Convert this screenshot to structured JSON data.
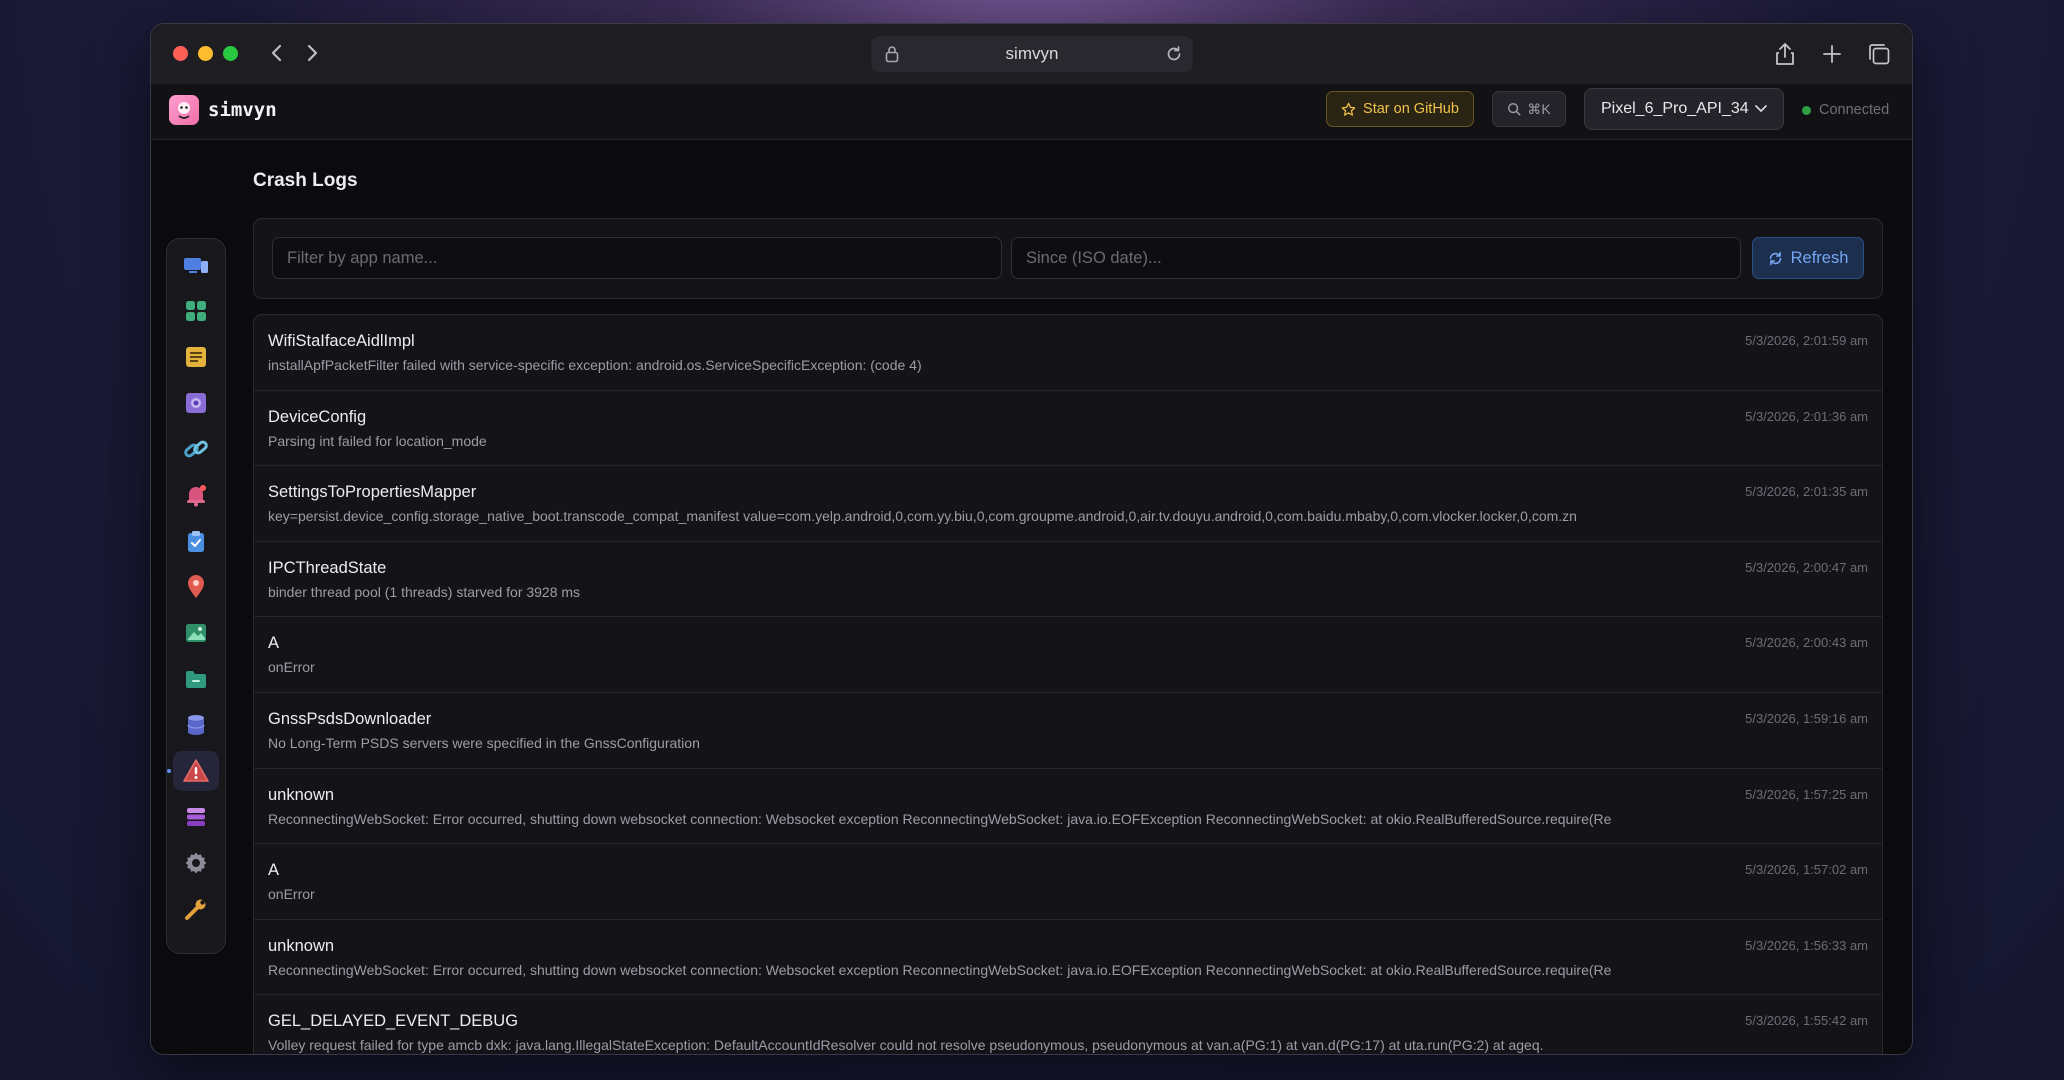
{
  "browser": {
    "url": "simvyn"
  },
  "header": {
    "brand": "simvyn",
    "star_label": "Star on GitHub",
    "shortcut": "⌘K",
    "device": "Pixel_6_Pro_API_34",
    "status": "Connected"
  },
  "sidebar": {
    "items": [
      {
        "icon": "devices-icon",
        "color": "#5b8ef0"
      },
      {
        "icon": "apps-grid-icon",
        "color": "#3fae7c"
      },
      {
        "icon": "notes-icon",
        "color": "#e3b23c"
      },
      {
        "icon": "screen-capture-icon",
        "color": "#8a6cd6"
      },
      {
        "icon": "link-icon",
        "color": "#4aa3c8"
      },
      {
        "icon": "notification-bell-icon",
        "color": "#e06a8f"
      },
      {
        "icon": "clipboard-icon",
        "color": "#4a8fe0"
      },
      {
        "icon": "location-pin-icon",
        "color": "#e05a4f"
      },
      {
        "icon": "media-image-icon",
        "color": "#3fae7c"
      },
      {
        "icon": "folder-icon",
        "color": "#3aa88a"
      },
      {
        "icon": "database-icon",
        "color": "#6a78d8"
      },
      {
        "icon": "crash-warning-icon",
        "color": "#e25a5a",
        "active": true
      },
      {
        "icon": "stack-icon",
        "color": "#a65ad6"
      },
      {
        "icon": "settings-gear-icon",
        "color": "#9a9aa6"
      },
      {
        "icon": "wrench-icon",
        "color": "#e3a23c"
      }
    ]
  },
  "page": {
    "title": "Crash Logs",
    "filter_app_placeholder": "Filter by app name...",
    "filter_since_placeholder": "Since (ISO date)...",
    "refresh_label": "Refresh"
  },
  "logs": [
    {
      "title": "WifiStaIfaceAidlImpl",
      "message": "installApfPacketFilter failed with service-specific exception: android.os.ServiceSpecificException: (code 4)",
      "time": "5/3/2026, 2:01:59 am"
    },
    {
      "title": "DeviceConfig",
      "message": "Parsing int failed for location_mode",
      "time": "5/3/2026, 2:01:36 am"
    },
    {
      "title": "SettingsToPropertiesMapper",
      "message": "key=persist.device_config.storage_native_boot.transcode_compat_manifest value=com.yelp.android,0,com.yy.biu,0,com.groupme.android,0,air.tv.douyu.android,0,com.baidu.mbaby,0,com.vlocker.locker,0,com.zn",
      "time": "5/3/2026, 2:01:35 am"
    },
    {
      "title": "IPCThreadState",
      "message": "binder thread pool (1 threads) starved for 3928 ms",
      "time": "5/3/2026, 2:00:47 am"
    },
    {
      "title": "A",
      "message": "onError",
      "time": "5/3/2026, 2:00:43 am"
    },
    {
      "title": "GnssPsdsDownloader",
      "message": "No Long-Term PSDS servers were specified in the GnssConfiguration",
      "time": "5/3/2026, 1:59:16 am"
    },
    {
      "title": "unknown",
      "message": "ReconnectingWebSocket: Error occurred, shutting down websocket connection: Websocket exception ReconnectingWebSocket: java.io.EOFException ReconnectingWebSocket: at okio.RealBufferedSource.require(Re",
      "time": "5/3/2026, 1:57:25 am"
    },
    {
      "title": "A",
      "message": "onError",
      "time": "5/3/2026, 1:57:02 am"
    },
    {
      "title": "unknown",
      "message": "ReconnectingWebSocket: Error occurred, shutting down websocket connection: Websocket exception ReconnectingWebSocket: java.io.EOFException ReconnectingWebSocket: at okio.RealBufferedSource.require(Re",
      "time": "5/3/2026, 1:56:33 am"
    },
    {
      "title": "GEL_DELAYED_EVENT_DEBUG",
      "message": "Volley request failed for type amcb dxk: java.lang.IllegalStateException: DefaultAccountIdResolver could not resolve pseudonymous, pseudonymous at van.a(PG:1) at van.d(PG:17) at uta.run(PG:2) at ageq.",
      "time": "5/3/2026, 1:55:42 am"
    }
  ]
}
